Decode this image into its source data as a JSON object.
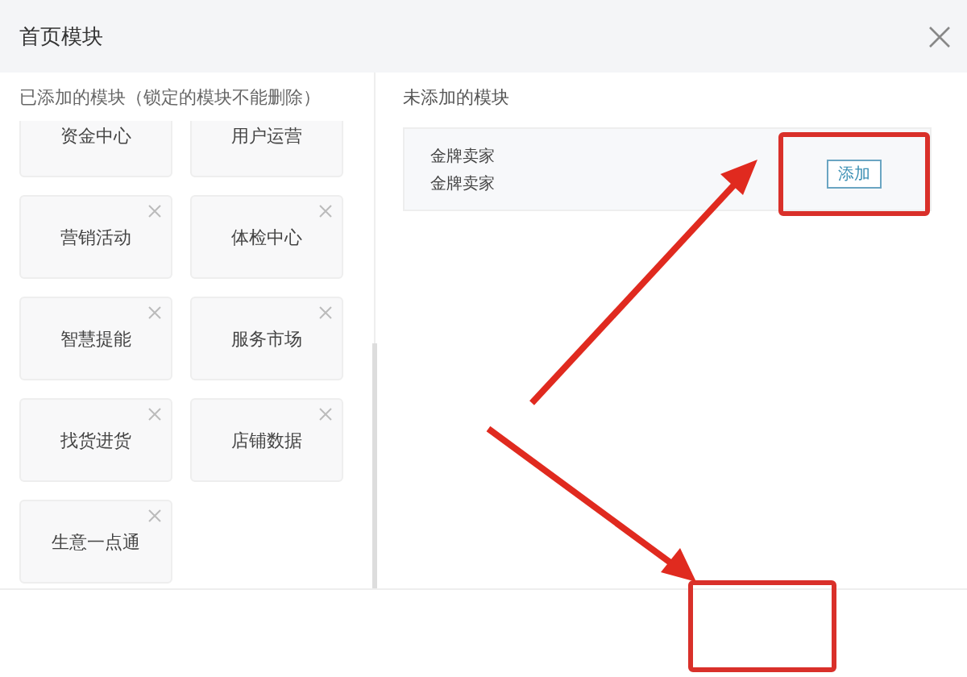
{
  "window": {
    "title": "首页模块"
  },
  "added": {
    "heading": "已添加的模块（锁定的模块不能删除）",
    "modules": [
      {
        "name": "资金中心"
      },
      {
        "name": "用户运营"
      },
      {
        "name": "营销活动",
        "removable": true
      },
      {
        "name": "体检中心",
        "removable": true
      },
      {
        "name": "智慧提能",
        "removable": true
      },
      {
        "name": "服务市场",
        "removable": true
      },
      {
        "name": "找货进货",
        "removable": true
      },
      {
        "name": "店铺数据",
        "removable": true
      },
      {
        "name": "生意一点通",
        "removable": true
      }
    ]
  },
  "not_added": {
    "heading": "未添加的模块",
    "modules": [
      {
        "lines": [
          "金牌卖家",
          "金牌卖家"
        ],
        "button": "添加",
        "highlighted": true
      }
    ]
  },
  "footer": {
    "highlighted": true
  }
}
